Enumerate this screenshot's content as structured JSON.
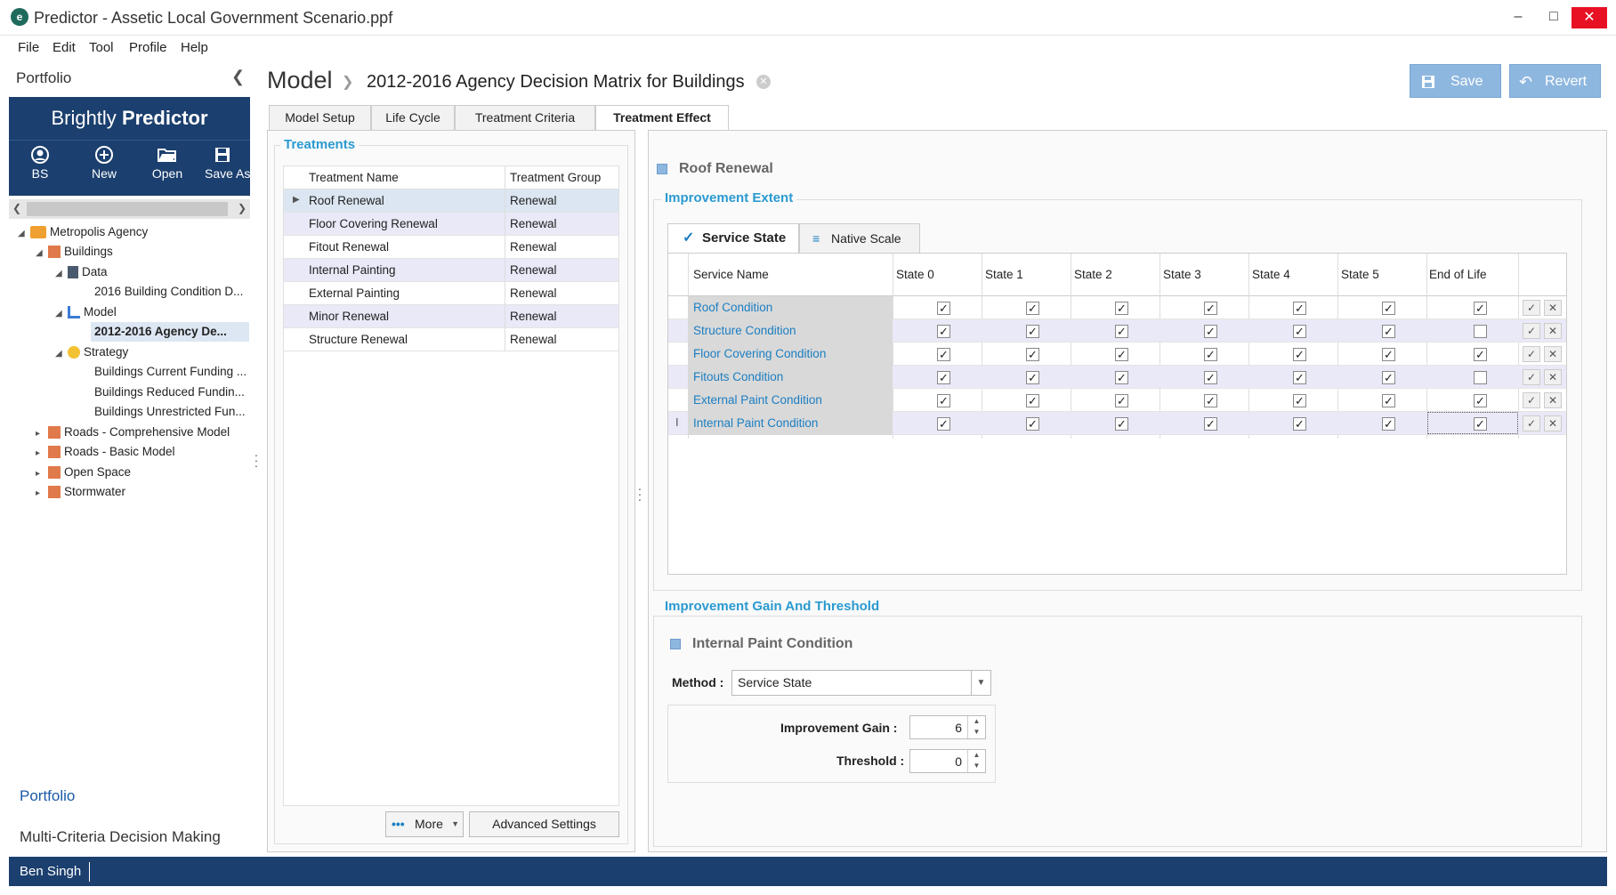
{
  "window": {
    "title": "Predictor - Assetic Local Government Scenario.ppf",
    "app_icon": "e"
  },
  "menu": [
    "File",
    "Edit",
    "Tool",
    "Profile",
    "Help"
  ],
  "sidebar": {
    "header": "Portfolio",
    "brand_light": "Brightly ",
    "brand_bold": "Predictor",
    "toolbar": [
      {
        "label": "BS",
        "icon": "user-icon"
      },
      {
        "label": "New",
        "icon": "plus-circle-icon"
      },
      {
        "label": "Open",
        "icon": "folder-open-icon"
      },
      {
        "label": "Save As",
        "icon": "save-icon"
      }
    ],
    "tree": [
      {
        "label": "Metropolis Agency",
        "icon": "agency-icon"
      },
      {
        "label": "Buildings",
        "icon": "building-icon"
      },
      {
        "label": "Data",
        "icon": "database-icon"
      },
      {
        "label": "2016 Building Condition D...",
        "icon": ""
      },
      {
        "label": "Model",
        "icon": "chart-icon"
      },
      {
        "label": "2012-2016 Agency De...",
        "icon": ""
      },
      {
        "label": "Strategy",
        "icon": "strategy-icon"
      },
      {
        "label": "Buildings Current Funding ...",
        "icon": ""
      },
      {
        "label": "Buildings Reduced Fundin...",
        "icon": ""
      },
      {
        "label": "Buildings Unrestricted Fun...",
        "icon": ""
      },
      {
        "label": "Roads - Comprehensive Model",
        "icon": "building-icon"
      },
      {
        "label": "Roads - Basic Model",
        "icon": "building-icon"
      },
      {
        "label": "Open Space",
        "icon": "building-icon"
      },
      {
        "label": "Stormwater",
        "icon": "building-icon"
      }
    ],
    "bottom_portfolio": "Portfolio",
    "bottom_mcdm": "Multi-Criteria Decision Making"
  },
  "header": {
    "section": "Model",
    "title": "2012-2016 Agency Decision Matrix for Buildings",
    "save": "Save",
    "revert": "Revert"
  },
  "tabs": [
    "Model Setup",
    "Life Cycle",
    "Treatment Criteria",
    "Treatment Effect"
  ],
  "treatments": {
    "title": "Treatments",
    "columns": [
      "Treatment Name",
      "Treatment Group"
    ],
    "rows": [
      [
        "Roof Renewal",
        "Renewal"
      ],
      [
        "Floor Covering Renewal",
        "Renewal"
      ],
      [
        "Fitout Renewal",
        "Renewal"
      ],
      [
        "Internal Painting",
        "Renewal"
      ],
      [
        "External Painting",
        "Renewal"
      ],
      [
        "Minor Renewal",
        "Renewal"
      ],
      [
        "Structure  Renewal",
        "Renewal"
      ]
    ],
    "more": "More",
    "advanced": "Advanced Settings"
  },
  "effect": {
    "treatment": "Roof Renewal",
    "extent_title": "Improvement Extent",
    "subtabs": [
      "Service State",
      "Native Scale"
    ],
    "columns": [
      "Service Name",
      "State 0",
      "State 1",
      "State 2",
      "State 3",
      "State 4",
      "State 5",
      "End of Life"
    ],
    "rows": [
      {
        "name": "Roof Condition",
        "checks": [
          true,
          true,
          true,
          true,
          true,
          true,
          true
        ]
      },
      {
        "name": "Structure Condition",
        "checks": [
          true,
          true,
          true,
          true,
          true,
          true,
          false
        ]
      },
      {
        "name": "Floor Covering Condition",
        "checks": [
          true,
          true,
          true,
          true,
          true,
          true,
          true
        ]
      },
      {
        "name": "Fitouts Condition",
        "checks": [
          true,
          true,
          true,
          true,
          true,
          true,
          false
        ]
      },
      {
        "name": "External Paint Condition",
        "checks": [
          true,
          true,
          true,
          true,
          true,
          true,
          true
        ]
      },
      {
        "name": "Internal Paint Condition",
        "checks": [
          true,
          true,
          true,
          true,
          true,
          true,
          true
        ]
      }
    ],
    "gain_title": "Improvement Gain And Threshold",
    "gain_service": "Internal Paint Condition",
    "method_label": "Method :",
    "method_value": "Service State",
    "gain_label": "Improvement Gain :",
    "gain_value": "6",
    "threshold_label": "Threshold :",
    "threshold_value": "0"
  },
  "status": {
    "user": "Ben Singh"
  }
}
